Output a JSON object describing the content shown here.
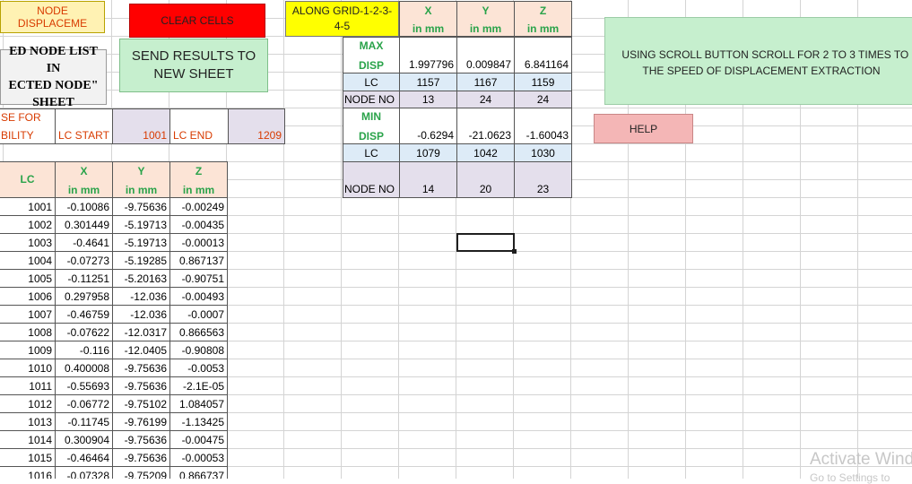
{
  "buttons": {
    "node_displacement": "NODE DISPLACEME",
    "clear_cells": "CLEAR CELLS",
    "send_results_line1": "SEND RESULTS TO",
    "send_results_line2": "NEW SHEET",
    "scroll_tip_line1": "USING SCROLL BUTTON SCROLL FOR 2 TO 3 TIMES TO IN",
    "scroll_tip_line2": "THE SPEED OF DISPLACEMENT EXTRACTION",
    "help": "HELP"
  },
  "left_panel": {
    "list_line1": "ED NODE LIST IN",
    "list_line2": "ECTED NODE\"",
    "list_line3": "SHEET",
    "case_line1": "SE FOR",
    "case_line2": "BILITY",
    "lc_start_label": "LC START",
    "lc_start_value": "1001",
    "lc_end_label": "LC END",
    "lc_end_value": "1209"
  },
  "summary": {
    "grid_label_line1": "ALONG GRID-1-2-3-",
    "grid_label_line2": "4-5",
    "headers": [
      {
        "axis": "X",
        "unit": "in mm"
      },
      {
        "axis": "Y",
        "unit": "in mm"
      },
      {
        "axis": "Z",
        "unit": "in mm"
      }
    ],
    "max_label_line1": "MAX",
    "max_label_line2": "DISP",
    "max_disp": [
      "1.997796",
      "0.009847",
      "6.841164"
    ],
    "lc_label": "LC",
    "max_lc": [
      "1157",
      "1167",
      "1159"
    ],
    "node_no_label": "NODE NO",
    "max_node": [
      "13",
      "24",
      "24"
    ],
    "min_label_line1": "MIN",
    "min_label_line2": "DISP",
    "min_disp": [
      "-0.6294",
      "-21.0623",
      "-1.60043"
    ],
    "min_lc": [
      "1079",
      "1042",
      "1030"
    ],
    "min_node": [
      "14",
      "20",
      "23"
    ]
  },
  "table": {
    "lc_header": "LC",
    "headers": [
      {
        "axis": "X",
        "unit": "in mm"
      },
      {
        "axis": "Y",
        "unit": "in mm"
      },
      {
        "axis": "Z",
        "unit": "in mm"
      }
    ],
    "rows": [
      [
        "1001",
        "-0.10086",
        "-9.75636",
        "-0.00249"
      ],
      [
        "1002",
        "0.301449",
        "-5.19713",
        "-0.00435"
      ],
      [
        "1003",
        "-0.4641",
        "-5.19713",
        "-0.00013"
      ],
      [
        "1004",
        "-0.07273",
        "-5.19285",
        "0.867137"
      ],
      [
        "1005",
        "-0.11251",
        "-5.20163",
        "-0.90751"
      ],
      [
        "1006",
        "0.297958",
        "-12.036",
        "-0.00493"
      ],
      [
        "1007",
        "-0.46759",
        "-12.036",
        "-0.0007"
      ],
      [
        "1008",
        "-0.07622",
        "-12.0317",
        "0.866563"
      ],
      [
        "1009",
        "-0.116",
        "-12.0405",
        "-0.90808"
      ],
      [
        "1010",
        "0.400008",
        "-9.75636",
        "-0.0053"
      ],
      [
        "1011",
        "-0.55693",
        "-9.75636",
        "-2.1E-05"
      ],
      [
        "1012",
        "-0.06772",
        "-9.75102",
        "1.084057"
      ],
      [
        "1013",
        "-0.11745",
        "-9.76199",
        "-1.13425"
      ],
      [
        "1014",
        "0.300904",
        "-9.75636",
        "-0.00475"
      ],
      [
        "1015",
        "-0.46464",
        "-9.75636",
        "-0.00053"
      ],
      [
        "1016",
        "-0.07328",
        "-9.75209",
        "0.866737"
      ]
    ]
  },
  "watermark": {
    "line1": "Activate Wind",
    "line2": "Go to Settings to"
  },
  "colors": {
    "yellow": "#ffff00",
    "red_button": "#ff0000",
    "green_button": "#c6efce",
    "peach": "#fce4d6",
    "lavender": "#e4dfec",
    "light_blue": "#ddebf7",
    "help_pink": "#f4b6b6",
    "green_text": "#2aa34a"
  }
}
